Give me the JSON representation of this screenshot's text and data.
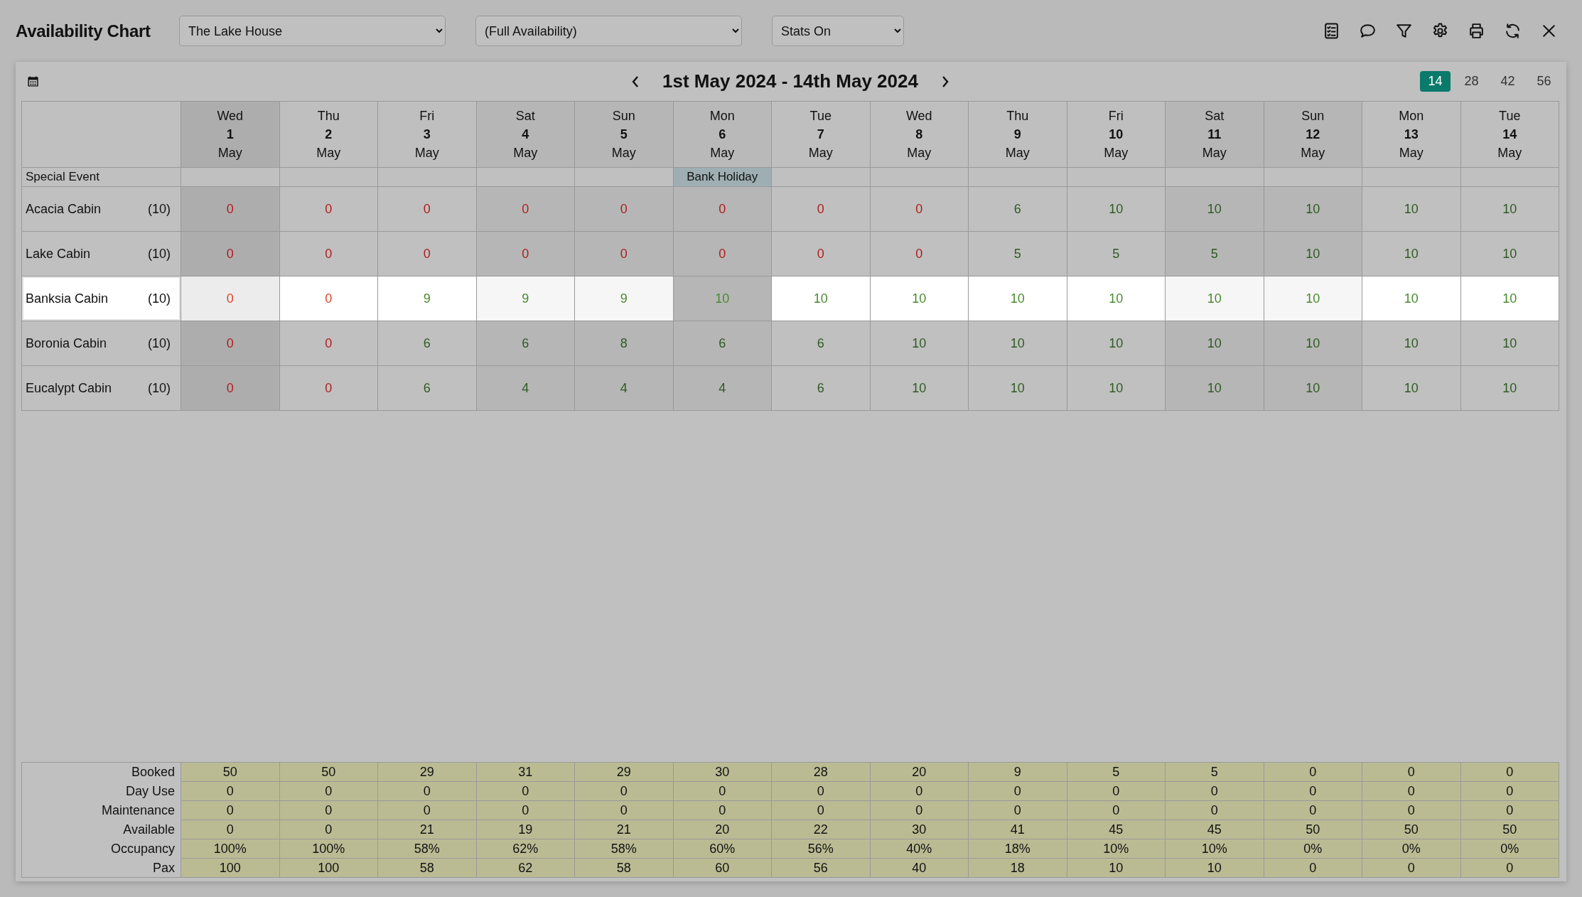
{
  "title": "Availability Chart",
  "filters": [
    "The Lake House",
    "(Full Availability)",
    "Stats On"
  ],
  "date_range": "1st May 2024 - 14th May 2024",
  "range_options": [
    {
      "label": "14",
      "selected": true
    },
    {
      "label": "28",
      "selected": false
    },
    {
      "label": "42",
      "selected": false
    },
    {
      "label": "56",
      "selected": false
    }
  ],
  "days": [
    {
      "weekday": "Wed",
      "date": "1",
      "month": "May",
      "kind": "today"
    },
    {
      "weekday": "Thu",
      "date": "2",
      "month": "May",
      "kind": "weekday"
    },
    {
      "weekday": "Fri",
      "date": "3",
      "month": "May",
      "kind": "weekday"
    },
    {
      "weekday": "Sat",
      "date": "4",
      "month": "May",
      "kind": "weekend"
    },
    {
      "weekday": "Sun",
      "date": "5",
      "month": "May",
      "kind": "weekend"
    },
    {
      "weekday": "Mon",
      "date": "6",
      "month": "May",
      "kind": "holiday",
      "event": "Bank Holiday"
    },
    {
      "weekday": "Tue",
      "date": "7",
      "month": "May",
      "kind": "weekday"
    },
    {
      "weekday": "Wed",
      "date": "8",
      "month": "May",
      "kind": "weekday"
    },
    {
      "weekday": "Thu",
      "date": "9",
      "month": "May",
      "kind": "weekday"
    },
    {
      "weekday": "Fri",
      "date": "10",
      "month": "May",
      "kind": "weekday"
    },
    {
      "weekday": "Sat",
      "date": "11",
      "month": "May",
      "kind": "weekend"
    },
    {
      "weekday": "Sun",
      "date": "12",
      "month": "May",
      "kind": "weekend"
    },
    {
      "weekday": "Mon",
      "date": "13",
      "month": "May",
      "kind": "weekday"
    },
    {
      "weekday": "Tue",
      "date": "14",
      "month": "May",
      "kind": "weekday"
    }
  ],
  "special_event_label": "Special Event",
  "rooms": [
    {
      "name": "Acacia Cabin",
      "count": "(10)",
      "selected": false,
      "cells": [
        {
          "value": "0",
          "sold_out": true
        },
        {
          "value": "0",
          "sold_out": true
        },
        {
          "value": "0",
          "sold_out": true
        },
        {
          "value": "0",
          "sold_out": true
        },
        {
          "value": "0",
          "sold_out": true
        },
        {
          "value": "0",
          "sold_out": true
        },
        {
          "value": "0",
          "sold_out": true
        },
        {
          "value": "0",
          "sold_out": true
        },
        {
          "value": "6",
          "sold_out": false
        },
        {
          "value": "10",
          "sold_out": false
        },
        {
          "value": "10",
          "sold_out": false
        },
        {
          "value": "10",
          "sold_out": false
        },
        {
          "value": "10",
          "sold_out": false
        },
        {
          "value": "10",
          "sold_out": false
        }
      ]
    },
    {
      "name": "Lake Cabin",
      "count": "(10)",
      "selected": false,
      "cells": [
        {
          "value": "0",
          "sold_out": true
        },
        {
          "value": "0",
          "sold_out": true
        },
        {
          "value": "0",
          "sold_out": true
        },
        {
          "value": "0",
          "sold_out": true
        },
        {
          "value": "0",
          "sold_out": true
        },
        {
          "value": "0",
          "sold_out": true
        },
        {
          "value": "0",
          "sold_out": true
        },
        {
          "value": "0",
          "sold_out": true
        },
        {
          "value": "5",
          "sold_out": false
        },
        {
          "value": "5",
          "sold_out": false
        },
        {
          "value": "5",
          "sold_out": false
        },
        {
          "value": "10",
          "sold_out": false
        },
        {
          "value": "10",
          "sold_out": false
        },
        {
          "value": "10",
          "sold_out": false
        }
      ]
    },
    {
      "name": "Banksia Cabin",
      "count": "(10)",
      "selected": true,
      "cells": [
        {
          "value": "0",
          "sold_out": true
        },
        {
          "value": "0",
          "sold_out": true
        },
        {
          "value": "9",
          "sold_out": false
        },
        {
          "value": "9",
          "sold_out": false
        },
        {
          "value": "9",
          "sold_out": false
        },
        {
          "value": "10",
          "sold_out": false
        },
        {
          "value": "10",
          "sold_out": false
        },
        {
          "value": "10",
          "sold_out": false
        },
        {
          "value": "10",
          "sold_out": false
        },
        {
          "value": "10",
          "sold_out": false
        },
        {
          "value": "10",
          "sold_out": false
        },
        {
          "value": "10",
          "sold_out": false
        },
        {
          "value": "10",
          "sold_out": false
        },
        {
          "value": "10",
          "sold_out": false
        }
      ]
    },
    {
      "name": "Boronia Cabin",
      "count": "(10)",
      "selected": false,
      "cells": [
        {
          "value": "0",
          "sold_out": true
        },
        {
          "value": "0",
          "sold_out": true
        },
        {
          "value": "6",
          "sold_out": false
        },
        {
          "value": "6",
          "sold_out": false
        },
        {
          "value": "8",
          "sold_out": false
        },
        {
          "value": "6",
          "sold_out": false
        },
        {
          "value": "6",
          "sold_out": false
        },
        {
          "value": "10",
          "sold_out": false
        },
        {
          "value": "10",
          "sold_out": false
        },
        {
          "value": "10",
          "sold_out": false
        },
        {
          "value": "10",
          "sold_out": false
        },
        {
          "value": "10",
          "sold_out": false
        },
        {
          "value": "10",
          "sold_out": false
        },
        {
          "value": "10",
          "sold_out": false
        }
      ]
    },
    {
      "name": "Eucalypt Cabin",
      "count": "(10)",
      "selected": false,
      "cells": [
        {
          "value": "0",
          "sold_out": true
        },
        {
          "value": "0",
          "sold_out": true
        },
        {
          "value": "6",
          "sold_out": false
        },
        {
          "value": "4",
          "sold_out": false
        },
        {
          "value": "4",
          "sold_out": false
        },
        {
          "value": "4",
          "sold_out": false
        },
        {
          "value": "6",
          "sold_out": false
        },
        {
          "value": "10",
          "sold_out": false
        },
        {
          "value": "10",
          "sold_out": false
        },
        {
          "value": "10",
          "sold_out": false
        },
        {
          "value": "10",
          "sold_out": false
        },
        {
          "value": "10",
          "sold_out": false
        },
        {
          "value": "10",
          "sold_out": false
        },
        {
          "value": "10",
          "sold_out": false
        }
      ]
    }
  ],
  "stats": [
    {
      "label": "Booked",
      "values": [
        "50",
        "50",
        "29",
        "31",
        "29",
        "30",
        "28",
        "20",
        "9",
        "5",
        "5",
        "0",
        "0",
        "0"
      ]
    },
    {
      "label": "Day Use",
      "values": [
        "0",
        "0",
        "0",
        "0",
        "0",
        "0",
        "0",
        "0",
        "0",
        "0",
        "0",
        "0",
        "0",
        "0"
      ]
    },
    {
      "label": "Maintenance",
      "values": [
        "0",
        "0",
        "0",
        "0",
        "0",
        "0",
        "0",
        "0",
        "0",
        "0",
        "0",
        "0",
        "0",
        "0"
      ]
    },
    {
      "label": "Available",
      "values": [
        "0",
        "0",
        "21",
        "19",
        "21",
        "20",
        "22",
        "30",
        "41",
        "45",
        "45",
        "50",
        "50",
        "50"
      ]
    },
    {
      "label": "Occupancy",
      "values": [
        "100%",
        "100%",
        "58%",
        "62%",
        "58%",
        "60%",
        "56%",
        "40%",
        "18%",
        "10%",
        "10%",
        "0%",
        "0%",
        "0%"
      ]
    },
    {
      "label": "Pax",
      "values": [
        "100",
        "100",
        "58",
        "62",
        "58",
        "60",
        "56",
        "40",
        "18",
        "10",
        "10",
        "0",
        "0",
        "0"
      ]
    }
  ]
}
